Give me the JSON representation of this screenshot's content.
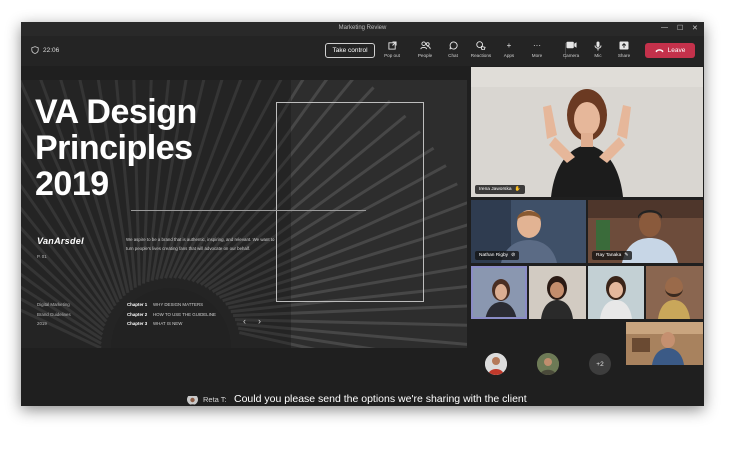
{
  "window": {
    "title": "Marketing Review"
  },
  "toolbar": {
    "timer": "22:06",
    "take_control": "Take control",
    "pop_out": "Pop out",
    "people": "People",
    "chat": "Chat",
    "reactions": "Reactions",
    "apps": "Apps",
    "more": "More",
    "camera": "Camera",
    "mic": "Mic",
    "share": "Share",
    "leave": "Leave"
  },
  "slide": {
    "title_lines": [
      "VA Design",
      "Principles",
      "2019"
    ],
    "logo": "VanArsdel",
    "body": "We aspire to be a brand that is authentic, inspiring, and relevant. We want to turn people's lives creating fans that will advocate on our behalf.",
    "page": "P. 01",
    "meta": [
      "Digital Marketing",
      "Brand Guidelines",
      "2019"
    ],
    "chapters": [
      {
        "num": "Chapter 1",
        "name": "WHY DESIGN MATTERS"
      },
      {
        "num": "Chapter 2",
        "name": "HOW TO USE THE GUIDELINE"
      },
      {
        "num": "Chapter 3",
        "name": "WHAT IS NEW"
      }
    ],
    "prev": "‹",
    "next": "›"
  },
  "participants": {
    "main": "Irena Jaworska",
    "tile2": "Nathan Rigby",
    "tile3": "Ray Tanaka",
    "more_count": "+2"
  },
  "caption": {
    "speaker": "Reta T:",
    "text": "Could you please send the options we're sharing with the client tomorrow?"
  },
  "colors": {
    "leave": "#c4314b",
    "background": "#1f1f1f",
    "toolbar": "#242424"
  }
}
